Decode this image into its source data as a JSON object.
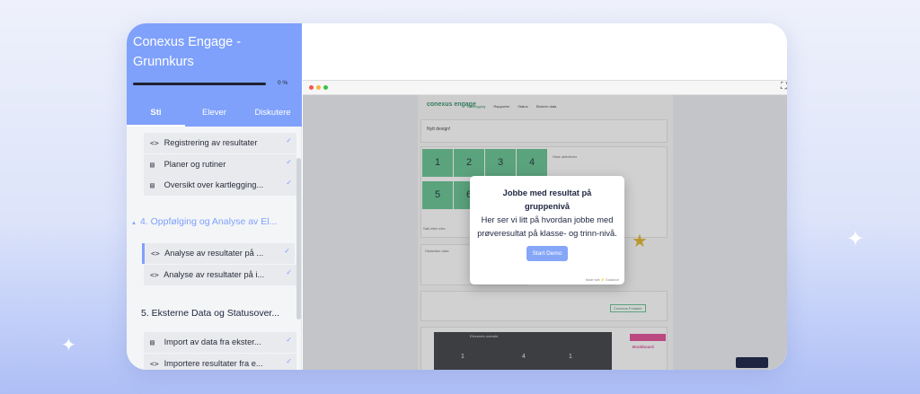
{
  "course": {
    "title": "Conexus Engage - Grunnkurs",
    "progress_percent": 0,
    "progress_label": "0 %"
  },
  "tabs": [
    {
      "label": "Sti",
      "active": true
    },
    {
      "label": "Elever",
      "active": false
    },
    {
      "label": "Diskutere",
      "active": false
    }
  ],
  "items_top": [
    {
      "icon": "code-icon",
      "glyph": "<>",
      "label": "Registrering av resultater",
      "done": true
    },
    {
      "icon": "book-icon",
      "glyph": "▤",
      "label": "Planer og rutiner",
      "done": true
    },
    {
      "icon": "book-icon",
      "glyph": "▤",
      "label": "Oversikt over kartlegging...",
      "done": true
    }
  ],
  "section4": {
    "label": "4. Oppfølging og Analyse av El...",
    "arrow": "▲"
  },
  "items_mid": [
    {
      "icon": "code-icon",
      "glyph": "<>",
      "label": "Analyse av resultater på ...",
      "done": true
    },
    {
      "icon": "code-icon",
      "glyph": "<>",
      "label": "Analyse av resultater på i...",
      "done": true
    }
  ],
  "section5": {
    "label": "5. Eksterne Data og Statusover...",
    "arrow": "▲"
  },
  "items_bottom": [
    {
      "icon": "book-icon",
      "glyph": "▤",
      "label": "Import av data fra ekster...",
      "done": true
    },
    {
      "icon": "code-icon",
      "glyph": "<>",
      "label": "Importere resultater fra e...",
      "done": true
    }
  ],
  "colors": {
    "accent": "#7fa1fb",
    "green": "#5bc08a",
    "text_dark": "#1d2540"
  },
  "app": {
    "logo": "conexus engage",
    "nav": [
      "Kartlegging",
      "Rapporter",
      "Status",
      "Ekstern data"
    ],
    "banner_title": "Nytt design!",
    "tiles": [
      "1",
      "2",
      "3",
      "4",
      "5",
      "6"
    ],
    "tile_header": "Skriv",
    "side_label": "Siste aktiviteter",
    "filter_label": "Søk etter elev",
    "history_label": "Historiske data",
    "link_button": "Conexus Forlader",
    "overview_label": "Elevenes oversikt",
    "overview_values": [
      "1",
      "4",
      "1"
    ],
    "promo": "Bookboard"
  },
  "modal": {
    "title": "Jobbe med resultat på gruppenivå",
    "body": "Her ser vi litt på hvordan jobbe med prøveresultat på klasse- og trinn-nivå.",
    "button": "Start Demo",
    "footer": "Made with ⚡ Guidance"
  }
}
